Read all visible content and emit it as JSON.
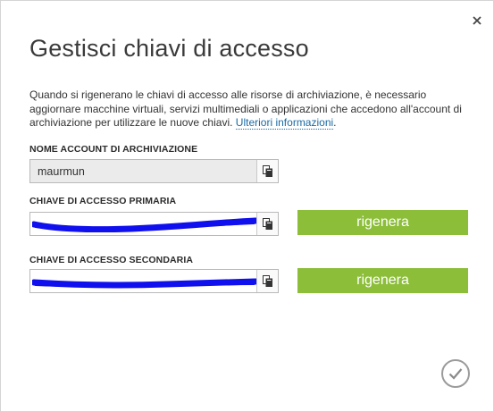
{
  "dialog": {
    "title": "Gestisci chiavi di accesso",
    "description": "Quando si rigenerano le chiavi di accesso alle risorse di archiviazione, è necessario aggiornare macchine virtuali, servizi multimediali o applicazioni che accedono all'account di archiviazione per utilizzare le nuove chiavi.",
    "more_info_link": "Ulteriori informazioni",
    "close_icon": "close-icon",
    "ok_icon": "checkmark-icon"
  },
  "account": {
    "label": "NOME ACCOUNT DI ARCHIVIAZIONE",
    "value": "maurmun"
  },
  "primary_key": {
    "label": "CHIAVE DI ACCESSO PRIMARIA",
    "regenerate_label": "rigenera"
  },
  "secondary_key": {
    "label": "CHIAVE DI ACCESSO SECONDARIA",
    "regenerate_label": "rigenera"
  },
  "colors": {
    "accent_green": "#8cbe3a",
    "redaction_blue": "#1010ee",
    "link_blue": "#1a6aa3"
  }
}
